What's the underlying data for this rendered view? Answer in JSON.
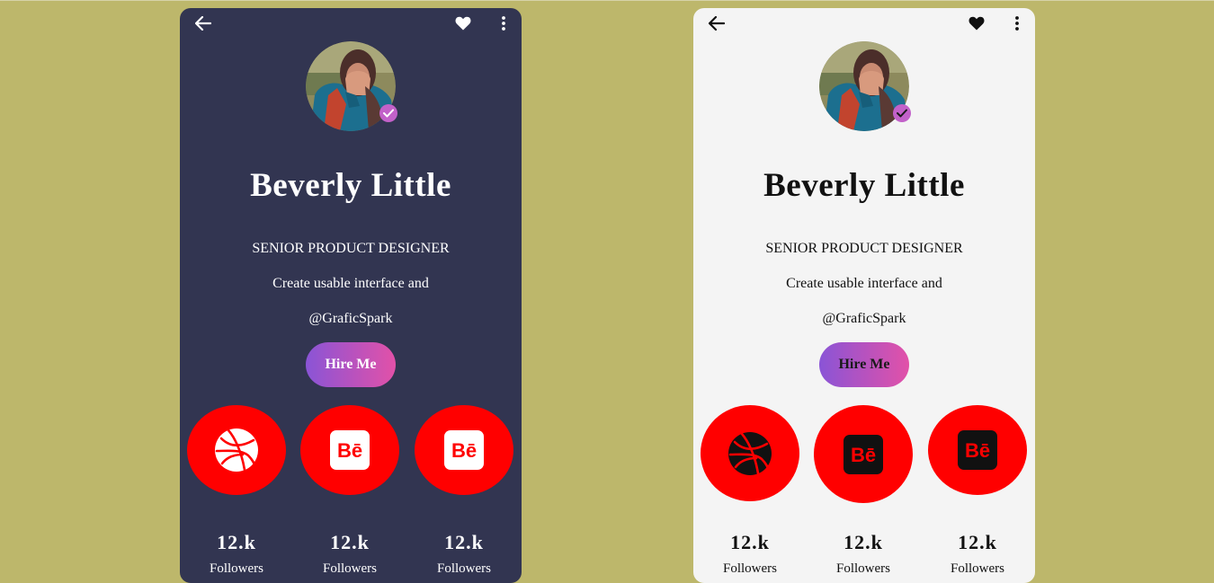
{
  "colors": {
    "page_background": "#bdb76b",
    "dark_card": "#323551",
    "light_card": "#f4f4f4",
    "social_bg": "#ff0000",
    "verified_badge": "#c261c9",
    "button_gradient": [
      "#8a54d6",
      "#e251a8"
    ]
  },
  "dark_card": {
    "profile": {
      "name": "Beverly Little",
      "title": "SENIOR PRODUCT DESIGNER",
      "bio": "Create usable interface and",
      "handle": "@GraficSpark"
    },
    "hire_label": "Hire Me",
    "icons": [
      "back-arrow-icon",
      "heart-icon",
      "more-vertical-icon",
      "verified-check-icon",
      "dribbble-icon",
      "behance-icon",
      "behance-icon"
    ],
    "stats": [
      {
        "value": "12.k",
        "label": "Followers"
      },
      {
        "value": "12.k",
        "label": "Followers"
      },
      {
        "value": "12.k",
        "label": "Followers"
      }
    ]
  },
  "light_card": {
    "profile": {
      "name": "Beverly Little",
      "title": "SENIOR PRODUCT DESIGNER",
      "bio": "Create usable interface and",
      "handle": "@GraficSpark"
    },
    "hire_label": "Hire Me",
    "icons": [
      "back-arrow-icon",
      "heart-icon",
      "more-vertical-icon",
      "verified-check-icon",
      "dribbble-icon",
      "behance-icon",
      "behance-icon"
    ],
    "stats": [
      {
        "value": "12.k",
        "label": "Followers"
      },
      {
        "value": "12.k",
        "label": "Followers"
      },
      {
        "value": "12.k",
        "label": "Followers"
      }
    ]
  }
}
